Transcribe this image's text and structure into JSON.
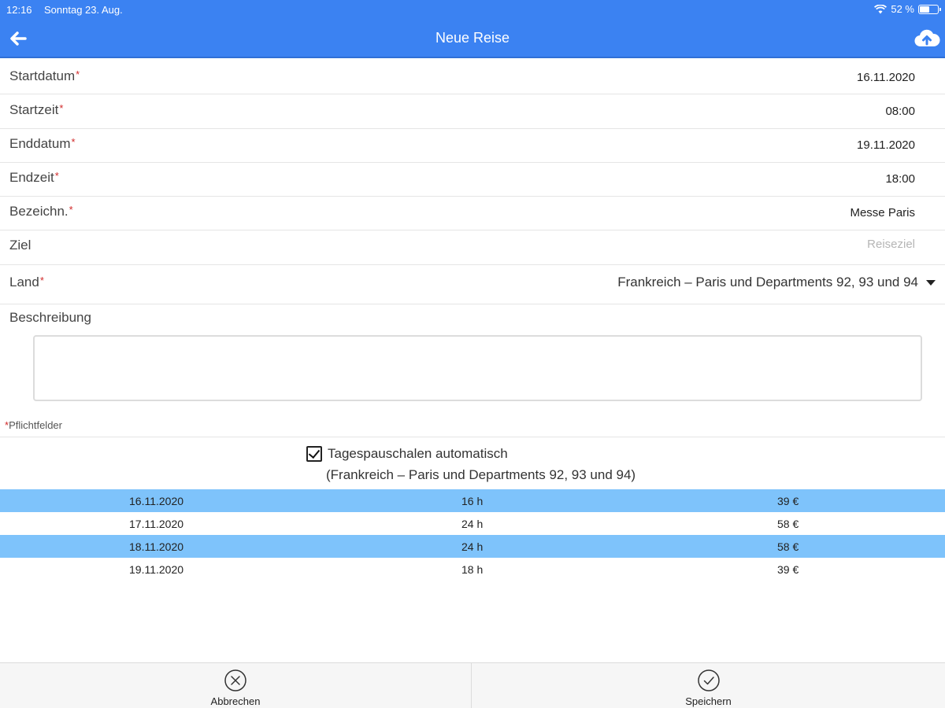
{
  "status_bar": {
    "time": "12:16",
    "date": "Sonntag 23. Aug.",
    "battery_text": "52 %"
  },
  "header": {
    "title": "Neue Reise",
    "back_icon": "arrow-left-icon",
    "upload_icon": "cloud-upload-icon",
    "color": "#3b82f2"
  },
  "form": {
    "startdatum": {
      "label": "Startdatum",
      "required": "*",
      "value": "16.11.2020"
    },
    "startzeit": {
      "label": "Startzeit",
      "required": "*",
      "value": "08:00"
    },
    "enddatum": {
      "label": "Enddatum",
      "required": "*",
      "value": "19.11.2020"
    },
    "endzeit": {
      "label": "Endzeit",
      "required": "*",
      "value": "18:00"
    },
    "bezeichnung": {
      "label": "Bezeichn.",
      "required": "*",
      "value": "Messe Paris"
    },
    "ziel": {
      "label": "Ziel",
      "placeholder": "Reiseziel"
    },
    "land": {
      "label": "Land",
      "required": "*",
      "value": "Frankreich – Paris und Departments 92, 93 und 94"
    },
    "beschreibung": {
      "label": "Beschreibung",
      "value": ""
    },
    "required_note": {
      "marker": "*",
      "text": "Pflichtfelder"
    }
  },
  "allowances": {
    "checkbox_label": "Tagespauschalen automatisch",
    "checked": true,
    "subtitle": "(Frankreich – Paris und Departments 92, 93 und 94)",
    "rows": [
      {
        "date": "16.11.2020",
        "hours": "16 h",
        "amount": "39 €"
      },
      {
        "date": "17.11.2020",
        "hours": "24 h",
        "amount": "58 €"
      },
      {
        "date": "18.11.2020",
        "hours": "24 h",
        "amount": "58 €"
      },
      {
        "date": "19.11.2020",
        "hours": "18 h",
        "amount": "39 €"
      }
    ],
    "highlight_color": "#7ec3fb"
  },
  "toolbar": {
    "cancel_label": "Abbrechen",
    "cancel_icon": "close-circle-icon",
    "save_label": "Speichern",
    "save_icon": "check-circle-icon"
  }
}
